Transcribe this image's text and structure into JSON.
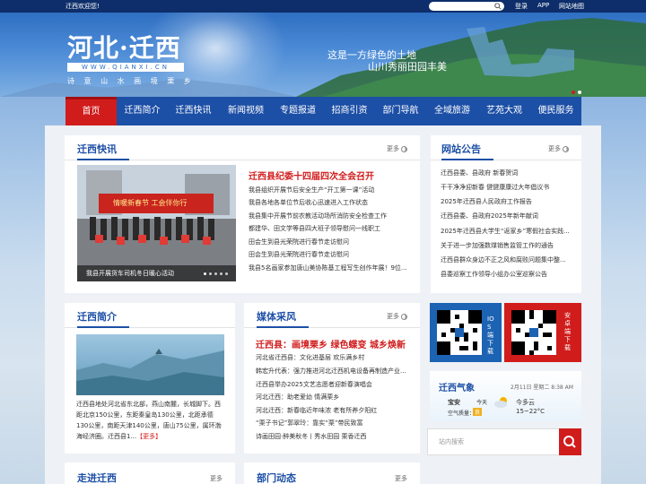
{
  "topbar": {
    "welcome": "迁西欢迎您!",
    "login": "登录",
    "app": "APP",
    "sitemap": "网站地图"
  },
  "banner": {
    "logo_title": "河北·迁西",
    "logo_url": "WWW.QIANXI.CN",
    "logo_slogan": "诗 意 山 水   画 境 栗 乡",
    "slogan1": "这是一方绿色的土地",
    "slogan2": "山川秀丽田园丰美"
  },
  "nav": {
    "items": [
      "首页",
      "迁西简介",
      "迁西快讯",
      "新闻视频",
      "专题报道",
      "招商引资",
      "部门导航",
      "全域旅游",
      "艺苑大观",
      "便民服务"
    ]
  },
  "common": {
    "more": "更多"
  },
  "news": {
    "title": "迁西快讯",
    "photo_caption": "我县开展货车司机冬日暖心活动",
    "photo_banner_text": "情暖新春节 工会伴你行",
    "headline": "迁西县纪委十四届四次全会召开",
    "items": [
      "我县组织开展节后安全生产“开工第一课”活动",
      "我县各地各单位节后收心迅速进入工作状态",
      "我县集中开展节前农教活动场所消防安全检查工作",
      "都建华、田文学等县四大班子领导慰问一线职工",
      "田会生到县光荣院进行春节走访慰问",
      "田会生到县光荣院进行春节走访慰问",
      "我县5名画家参加唐山美协陈基工程写生创作年展！9位..."
    ]
  },
  "notice": {
    "title": "网站公告",
    "items": [
      "迁西县委、县政府 新春贺词",
      "干干净净迎新春 健健康康过大年倡议书",
      "2025年迁西县人民政府工作报告",
      "迁西县委、县政府2025年新年献词",
      "2025年迁西县大学生“返家乡”寒假社会实践...",
      "关于进一步加强数煤销售监管工作的通告",
      "迁西县群众身边不正之风和腐败问题集中整...",
      "县委巡察工作领导小组办公室巡察公告"
    ]
  },
  "intro": {
    "title": "迁西简介",
    "text": "迁西县地处河北省东北部，燕山南麓，长城脚下。西距北京150公里，东距秦皇岛130公里，北距承德130公里，南距天津140公里，唐山75公里，属环渤海经济圈。迁西县1...",
    "more_link": "【更多】"
  },
  "media": {
    "title": "媒体采风",
    "headline": "迁西县：画境栗乡 绿色蝶变 城乡焕新",
    "items": [
      "河北省迁西县：文化进基层 欢乐满乡村",
      "韩宏升代表：强力推进河北迁西机电设备再制造产业...",
      "迁西县举办2025文艺志愿者迎新春演唱会",
      "河北迁西：助老爱幼 情满栗乡",
      "河北迁西：新春临近年味浓 老有所养夕阳红",
      "“栗子书记”郭翠玲：靠实“栗”带民致富",
      "诗画田园·醉美秋冬丨秀水田园 栗香迁西"
    ]
  },
  "qr": {
    "ios": "IOS端下载",
    "android": "安卓端下载"
  },
  "weather": {
    "title": "迁西气象",
    "date": "2月11日 星期二 8:38 AM",
    "city": "宝安",
    "air_label": "空气质量：",
    "air_value": "良",
    "today": "今天",
    "condition": "今多云",
    "temperature": "15~22°C"
  },
  "search": {
    "placeholder": "站内搜索"
  },
  "walk": {
    "title": "走进迁西"
  },
  "dept": {
    "title": "部门动态"
  }
}
